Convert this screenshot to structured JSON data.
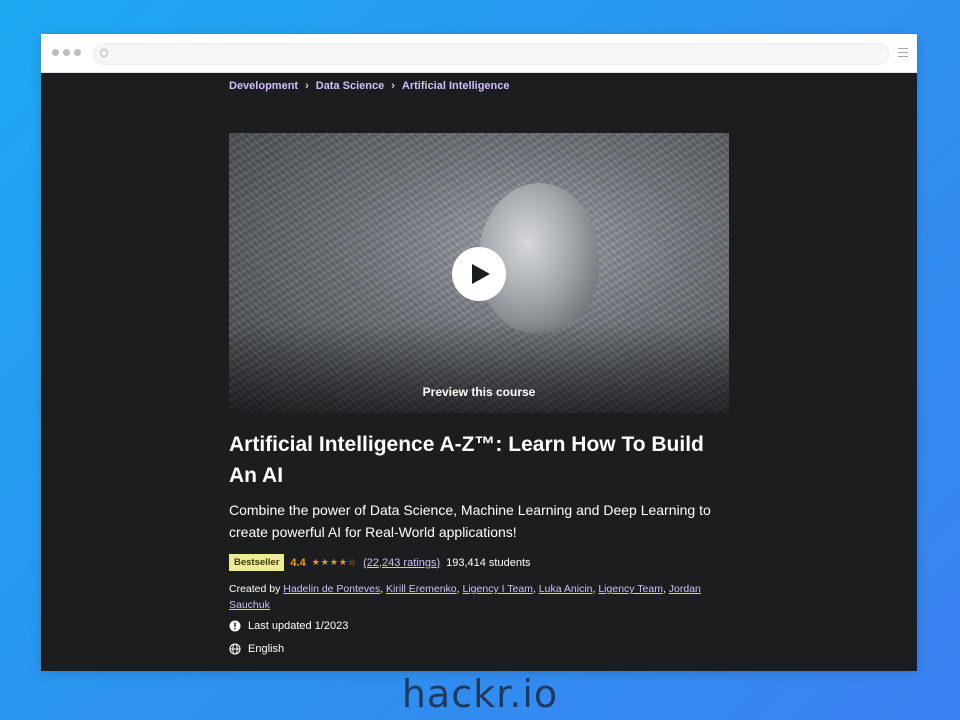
{
  "breadcrumb": [
    "Development",
    "Data Science",
    "Artificial Intelligence"
  ],
  "preview": {
    "label": "Preview this course"
  },
  "course": {
    "title": "Artificial Intelligence A-Z™: Learn How To Build An AI",
    "subtitle": "Combine the power of Data Science, Machine Learning and Deep Learning to create powerful AI for Real-World applications!",
    "badge": "Bestseller",
    "rating": "4.4",
    "rating_fraction": 0.88,
    "ratings_count": "(22,243 ratings)",
    "students": "193,414 students",
    "created_by_label": "Created by",
    "instructors": [
      "Hadelin de Ponteves",
      "Kirill Eremenko",
      "Ligency I Team",
      "Luka Anicin",
      "Ligency Team",
      "Jordan Sauchuk"
    ],
    "last_updated": "Last updated 1/2023",
    "language": "English"
  },
  "watermark": "hackr.io",
  "colors": {
    "background": "#1c1d1f",
    "accent_link": "#cec0fc",
    "badge": "#eceb98",
    "star": "#f69c08"
  }
}
